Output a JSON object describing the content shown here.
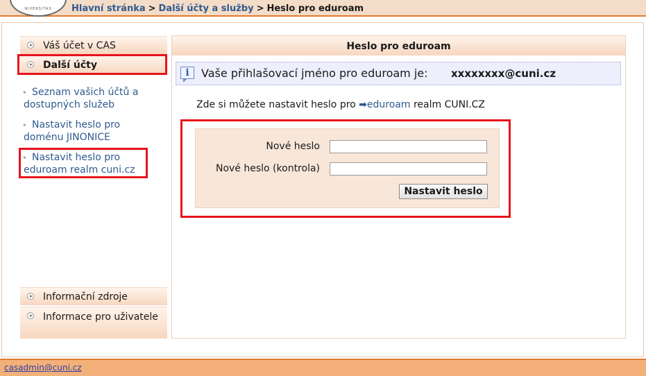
{
  "header": {
    "logo_text": "· NIVERSITAS ·",
    "breadcrumb": {
      "home": "Hlavní stránka",
      "separator": ">",
      "section": "Další účty a služby",
      "current": "Heslo pro eduroam"
    }
  },
  "sidebar": {
    "account_cas": "Váš účet v CAS",
    "other_accounts": "Další účty",
    "links": [
      {
        "label": "Seznam vašich účtů a dostupných služeb"
      },
      {
        "label": "Nastavit heslo pro doménu JINONICE"
      },
      {
        "label": "Nastavit heslo pro eduroam realm cuni.cz"
      }
    ],
    "info_sources": "Informační zdroje",
    "user_info": "Informace pro uživatele"
  },
  "main": {
    "title": "Heslo pro eduroam",
    "info_icon": "i",
    "info_text": "Vaše přihlašovací jméno pro eduroam je:",
    "username": "xxxxxxxx@cuni.cz",
    "intro_prefix": "Zde si můžete nastavit heslo pro",
    "intro_arrow": "➡",
    "intro_link": "eduroam",
    "intro_suffix": "realm CUNI.CZ",
    "form": {
      "new_password_label": "Nové heslo",
      "new_password_value": "",
      "confirm_password_label": "Nové heslo (kontrola)",
      "confirm_password_value": "",
      "submit_label": "Nastavit heslo"
    }
  },
  "footer": {
    "email": "casadmin@cuni.cz"
  },
  "colors": {
    "accent_orange": "#e07b2e",
    "link_blue": "#2f5a8f",
    "highlight_red": "#e8131b"
  }
}
